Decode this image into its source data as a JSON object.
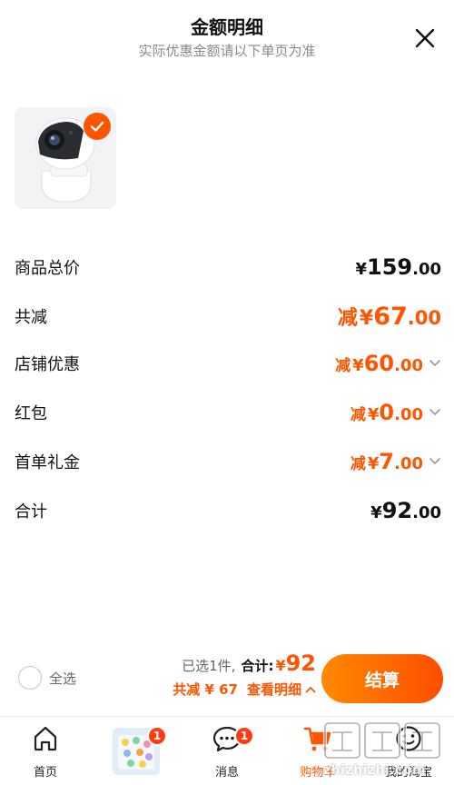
{
  "header": {
    "title": "金额明细",
    "subtitle": "实际优惠金额请以下单页为准"
  },
  "price_rows": [
    {
      "label": "商品总价",
      "prefix": "",
      "yen": "¥",
      "int": "159",
      "dec": ".00"
    },
    {
      "label": "共减",
      "prefix": "减",
      "yen": "¥",
      "int": "67",
      "dec": ".00"
    },
    {
      "label": "店铺优惠",
      "prefix": "减",
      "yen": "¥",
      "int": "60",
      "dec": ".00"
    },
    {
      "label": "红包",
      "prefix": "减",
      "yen": "¥",
      "int": "0",
      "dec": ".00"
    },
    {
      "label": "首单礼金",
      "prefix": "减",
      "yen": "¥",
      "int": "7",
      "dec": ".00"
    },
    {
      "label": "合计",
      "prefix": "",
      "yen": "¥",
      "int": "92",
      "dec": ".00"
    }
  ],
  "footer": {
    "select_all": "全选",
    "selected_count": "已选1件,",
    "total_label": "合计:",
    "total_yen": "¥",
    "total_value": "92",
    "discount_text": "共减 ¥ 67",
    "detail_link": "查看明细",
    "checkout": "结算"
  },
  "tabbar": {
    "home": "首页",
    "messages": "消息",
    "messages_badge": "1",
    "promo_badge": "1",
    "cart": "购物车",
    "mine": "我的淘宝"
  },
  "colors": {
    "accent": "#ff5500",
    "badge": "#ff3d10"
  },
  "watermark": {
    "text": "值 么 值",
    "url": "zhizhizhi.com"
  }
}
